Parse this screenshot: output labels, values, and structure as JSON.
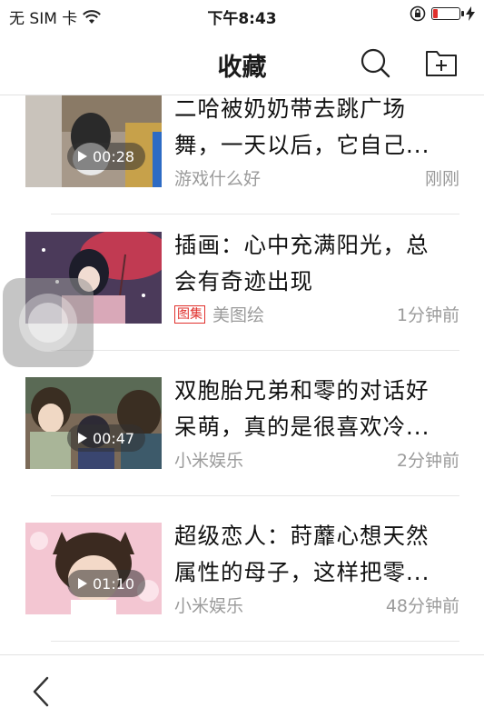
{
  "status_bar": {
    "carrier": "无 SIM 卡",
    "time": "下午8:43",
    "battery_level": 0.15,
    "battery_color": "#e0302c"
  },
  "nav": {
    "title": "收藏"
  },
  "items": [
    {
      "title_line1": "二哈被奶奶带去跳广场",
      "title_line2": "舞，一天以后，它自己...",
      "duration": "00:28",
      "source": "游戏什么好",
      "time": "刚刚"
    },
    {
      "title_line1": "插画：心中充满阳光，总",
      "title_line2": "会有奇迹出现",
      "tag": "图集",
      "source": "美图绘",
      "time": "1分钟前"
    },
    {
      "title_line1": "双胞胎兄弟和零的对话好",
      "title_line2": "呆萌，真的是很喜欢冷...",
      "duration": "00:47",
      "source": "小米娱乐",
      "time": "2分钟前"
    },
    {
      "title_line1": "超级恋人：莳蘼心想天然",
      "title_line2": "属性的母子，这样把零...",
      "duration": "01:10",
      "source": "小米娱乐",
      "time": "48分钟前"
    }
  ],
  "colors": {
    "accent_red": "#e0302c",
    "meta_gray": "#9b9b9b",
    "divider": "#e6e6e6"
  },
  "icons": [
    "wifi-icon",
    "lock-rotation-icon",
    "battery-icon",
    "charging-icon",
    "search-icon",
    "add-folder-icon",
    "play-icon",
    "assistive-touch-icon",
    "back-chevron-icon"
  ]
}
